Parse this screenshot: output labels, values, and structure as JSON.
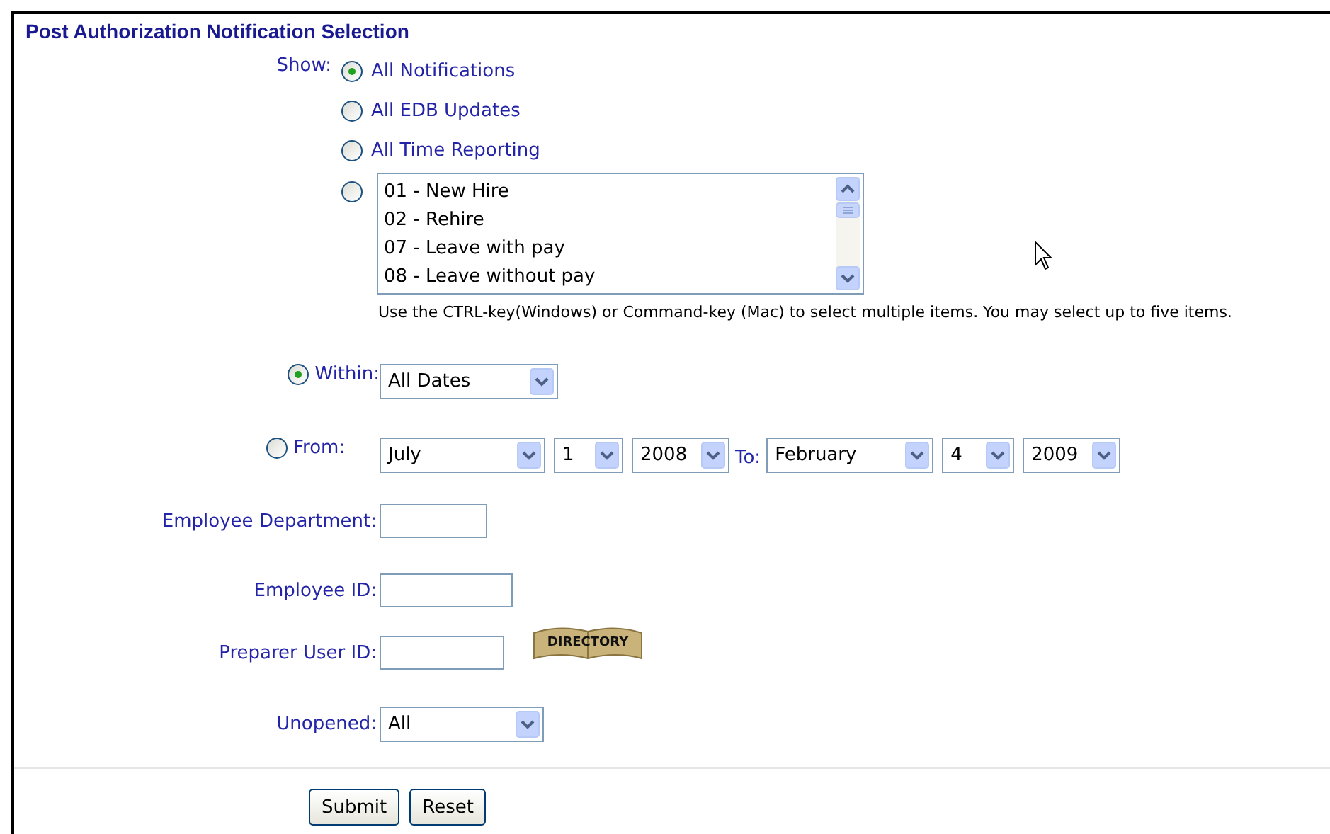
{
  "title": "Post Authorization Notification Selection",
  "show": {
    "label": "Show:",
    "options": [
      {
        "kind": "radio",
        "label": "All Notifications",
        "selected": true
      },
      {
        "kind": "radio",
        "label": "All EDB Updates",
        "selected": false
      },
      {
        "kind": "radio",
        "label": "All Time Reporting",
        "selected": false
      },
      {
        "kind": "listbox",
        "selected": false,
        "items": [
          "01 - New Hire",
          "02 - Rehire",
          "07 - Leave with pay",
          "08 - Leave without pay"
        ]
      }
    ]
  },
  "hint": "Use the CTRL-key(Windows) or Command-key (Mac) to select multiple items. You may select up to five items.",
  "date_filter": [
    {
      "kind": "within",
      "label": "Within:",
      "selected": true,
      "value": "All Dates"
    },
    {
      "kind": "range",
      "label": "From:",
      "selected": false,
      "from": [
        "July",
        "1",
        "2008"
      ],
      "to_label": "To:",
      "to": [
        "February",
        "4",
        "2009"
      ]
    }
  ],
  "fields": [
    {
      "kind": "text",
      "label": "Employee Department:"
    },
    {
      "kind": "text",
      "label": "Employee ID:"
    },
    {
      "kind": "text",
      "label": "Preparer User ID:",
      "button": "DIRECTORY"
    },
    {
      "kind": "select",
      "label": "Unopened:",
      "value": "All"
    }
  ],
  "buttons": [
    "Submit",
    "Reset"
  ]
}
